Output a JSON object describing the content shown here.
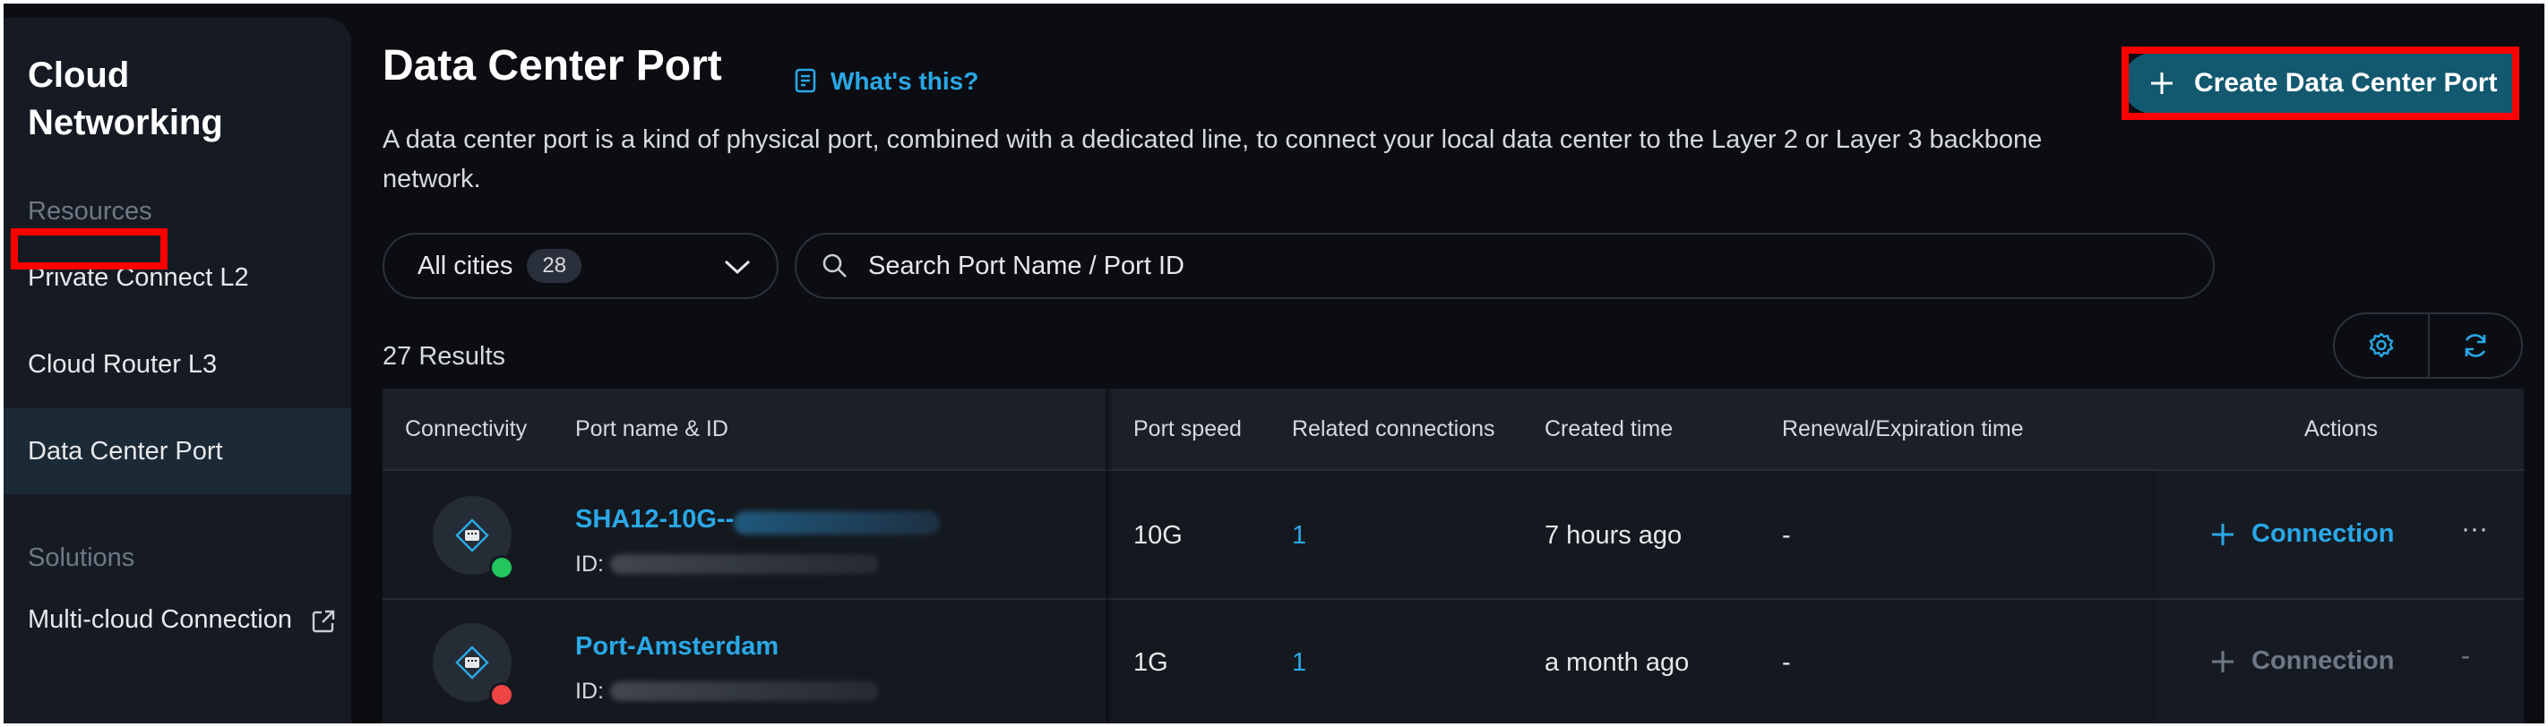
{
  "sidebar": {
    "title": "Cloud Networking",
    "resources_label": "Resources",
    "items": [
      {
        "label": "Private Connect L2"
      },
      {
        "label": "Cloud Router L3"
      },
      {
        "label": "Data Center Port"
      }
    ],
    "solutions_label": "Solutions",
    "solutions": [
      {
        "label": "Multi-cloud Connection",
        "icon": "external-link-icon"
      }
    ]
  },
  "header": {
    "title": "Data Center Port",
    "help_link": "What's this?",
    "help_icon": "document-icon",
    "description": "A data center port is a kind of physical port, combined with a dedicated line, to connect your local data center to the Layer 2 or Layer 3 backbone network.",
    "create_button": "Create Data Center Port"
  },
  "filters": {
    "city_select": {
      "value": "All cities",
      "count": "28"
    },
    "search_placeholder": "Search Port Name / Port ID"
  },
  "results_label": "27 Results",
  "toolbar": {
    "settings_icon": "gear-icon",
    "refresh_icon": "refresh-icon"
  },
  "table": {
    "columns": [
      "Connectivity",
      "Port name & ID",
      "Port speed",
      "Related connections",
      "Created time",
      "Renewal/Expiration time",
      "Actions"
    ],
    "rows": [
      {
        "name": "SHA12-10G--",
        "id_label": "ID:",
        "speed": "10G",
        "related": "1",
        "created": "7 hours ago",
        "renewal": "-",
        "action_label": "Connection",
        "more": "···",
        "status": "online",
        "status_color": "#22c55e",
        "action_enabled": true
      },
      {
        "name": "Port-Amsterdam",
        "id_label": "ID:",
        "speed": "1G",
        "related": "1",
        "created": "a month ago",
        "renewal": "-",
        "action_label": "Connection",
        "more": "-",
        "status": "offline",
        "status_color": "#ef4444",
        "action_enabled": false
      }
    ]
  },
  "colors": {
    "accent": "#2aa8e6",
    "primary_button": "#12586f",
    "highlight": "#ff0000",
    "background": "#0b0d12"
  }
}
